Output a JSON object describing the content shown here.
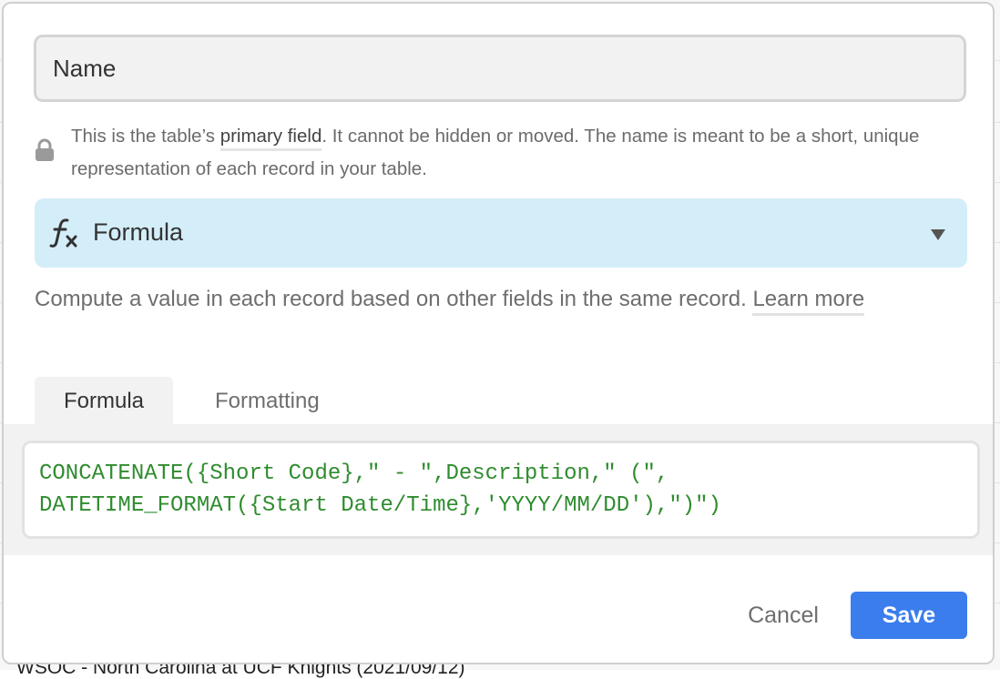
{
  "background": {
    "row_text": "WSOC - North Carolina at UCF Knights (2021/09/12)"
  },
  "name_field": {
    "value": "Name"
  },
  "primary_note": {
    "before": "This is the table’s ",
    "link": "primary field",
    "after": ". It cannot be hidden or moved. The name is meant to be a short, unique representation of each record in your table."
  },
  "field_type": {
    "icon": "fx-icon",
    "label": "Formula",
    "background_color": "#d4eef9"
  },
  "description": {
    "text": "Compute a value in each record based on other fields in the same record. ",
    "link": "Learn more"
  },
  "tabs": [
    {
      "label": "Formula",
      "active": true
    },
    {
      "label": "Formatting",
      "active": false
    }
  ],
  "formula": {
    "code": "CONCATENATE({Short Code},\" - \",Description,\" (\",\nDATETIME_FORMAT({Start Date/Time},'YYYY/MM/DD'),\")\")",
    "color": "#2f8c2f"
  },
  "actions": {
    "cancel_label": "Cancel",
    "save_label": "Save",
    "save_color": "#3b7ded"
  }
}
